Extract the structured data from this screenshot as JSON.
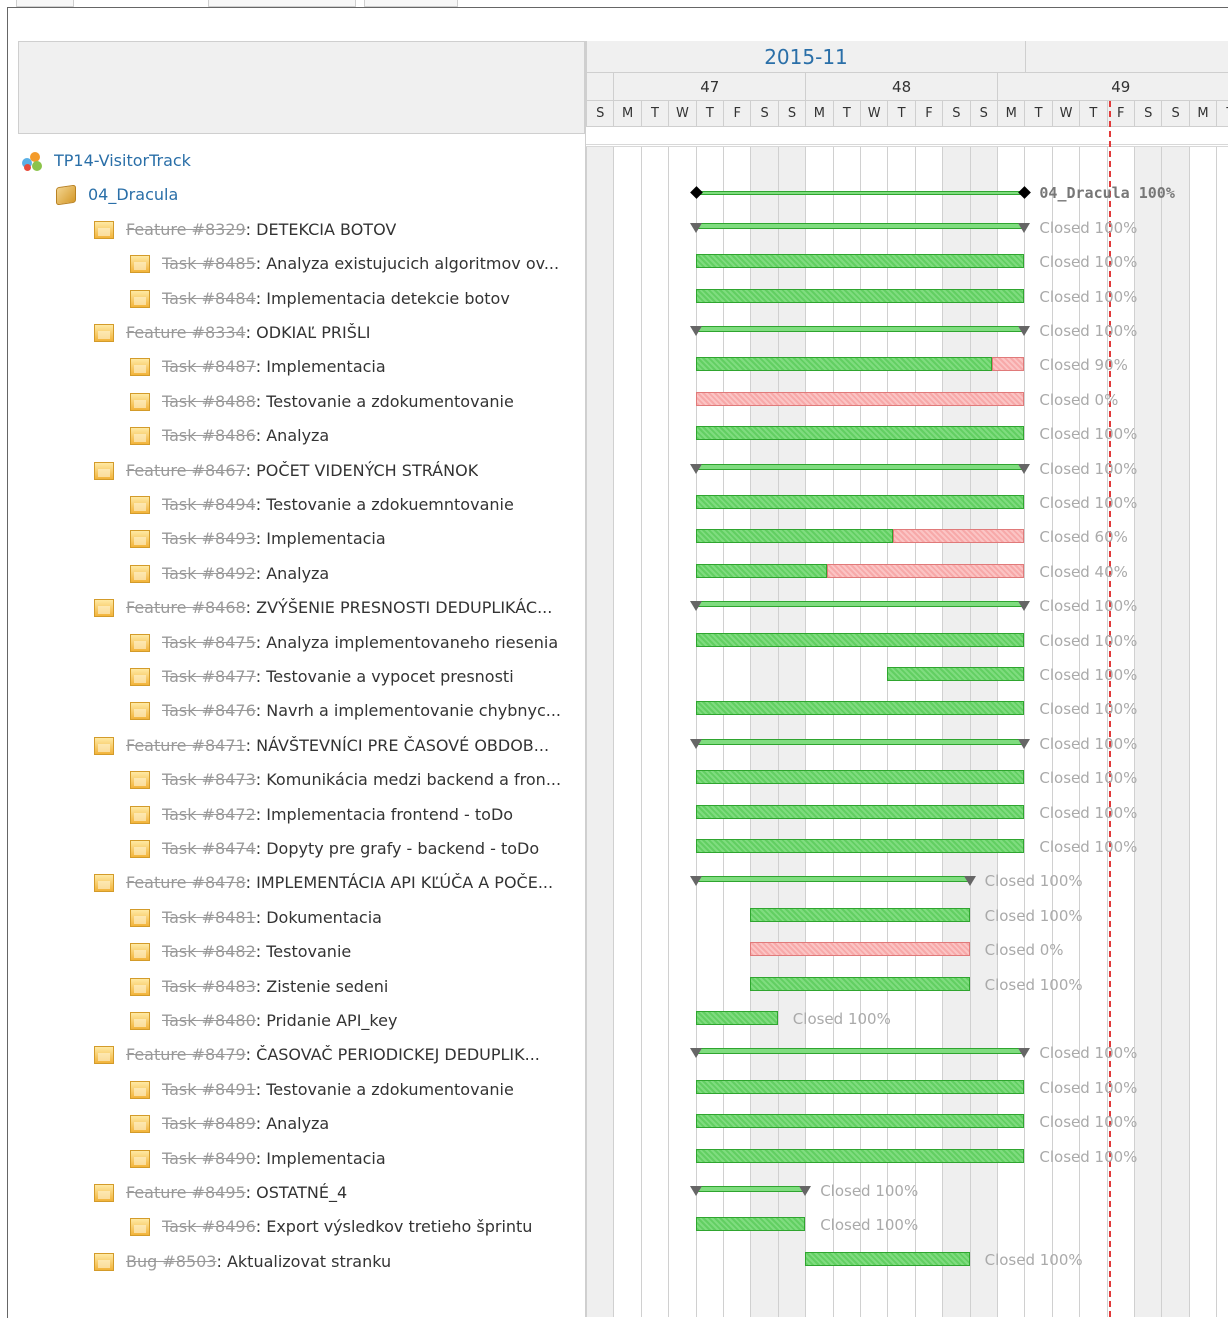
{
  "timeline": {
    "month": "2015-11",
    "weeks": [
      "47",
      "48",
      "49"
    ],
    "days": [
      "S",
      "M",
      "T",
      "W",
      "T",
      "F",
      "S",
      "S",
      "M",
      "T",
      "W",
      "T",
      "F",
      "S",
      "S",
      "M",
      "T",
      "W",
      "T",
      "F",
      "S",
      "S",
      "M",
      "T"
    ]
  },
  "tree": [
    {
      "type": "project",
      "label": "TP14-VisitorTrack"
    },
    {
      "type": "version",
      "label": "04_Dracula"
    },
    {
      "type": "feature",
      "id": "Feature #8329",
      "title": ": DETEKCIA BOTOV"
    },
    {
      "type": "task",
      "id": "Task #8485",
      "title": ": Analyza existujucich algoritmov ov..."
    },
    {
      "type": "task",
      "id": "Task #8484",
      "title": ": Implementacia detekcie botov"
    },
    {
      "type": "feature",
      "id": "Feature #8334",
      "title": ": ODKIAĽ PRIŠLI"
    },
    {
      "type": "task",
      "id": "Task #8487",
      "title": ": Implementacia"
    },
    {
      "type": "task",
      "id": "Task #8488",
      "title": ": Testovanie a zdokumentovanie"
    },
    {
      "type": "task",
      "id": "Task #8486",
      "title": ": Analyza"
    },
    {
      "type": "feature",
      "id": "Feature #8467",
      "title": ": POČET VIDENÝCH STRÁNOK"
    },
    {
      "type": "task",
      "id": "Task #8494",
      "title": ": Testovanie a zdokuemntovanie"
    },
    {
      "type": "task",
      "id": "Task #8493",
      "title": ": Implementacia"
    },
    {
      "type": "task",
      "id": "Task #8492",
      "title": ": Analyza"
    },
    {
      "type": "feature",
      "id": "Feature #8468",
      "title": ": ZVÝŠENIE PRESNOSTI DEDUPLIKÁC..."
    },
    {
      "type": "task",
      "id": "Task #8475",
      "title": ": Analyza implementovaneho riesenia"
    },
    {
      "type": "task",
      "id": "Task #8477",
      "title": ": Testovanie a vypocet presnosti"
    },
    {
      "type": "task",
      "id": "Task #8476",
      "title": ": Navrh a implementovanie chybnyc..."
    },
    {
      "type": "feature",
      "id": "Feature #8471",
      "title": ": NÁVŠTEVNÍCI PRE ČASOVÉ OBDOB..."
    },
    {
      "type": "task",
      "id": "Task #8473",
      "title": ": Komunikácia medzi backend a fron..."
    },
    {
      "type": "task",
      "id": "Task #8472",
      "title": ": Implementacia frontend - toDo"
    },
    {
      "type": "task",
      "id": "Task #8474",
      "title": ": Dopyty pre grafy - backend - toDo"
    },
    {
      "type": "feature",
      "id": "Feature #8478",
      "title": ": IMPLEMENTÁCIA API KĽÚČA A POČE..."
    },
    {
      "type": "task",
      "id": "Task #8481",
      "title": ": Dokumentacia"
    },
    {
      "type": "task",
      "id": "Task #8482",
      "title": ": Testovanie"
    },
    {
      "type": "task",
      "id": "Task #8483",
      "title": ": Zistenie sedeni"
    },
    {
      "type": "task",
      "id": "Task #8480",
      "title": ": Pridanie API_key"
    },
    {
      "type": "feature",
      "id": "Feature #8479",
      "title": ": ČASOVAČ PERIODICKEJ DEDUPLIK..."
    },
    {
      "type": "task",
      "id": "Task #8491",
      "title": ": Testovanie a zdokumentovanie"
    },
    {
      "type": "task",
      "id": "Task #8489",
      "title": ": Analyza"
    },
    {
      "type": "task",
      "id": "Task #8490",
      "title": ": Implementacia"
    },
    {
      "type": "feature",
      "id": "Feature #8495",
      "title": ": OSTATNÉ_4"
    },
    {
      "type": "task",
      "id": "Task #8496",
      "title": ": Export výsledkov tretieho šprintu"
    },
    {
      "type": "feature",
      "id": "Bug #8503",
      "title": ": Aktualizovat stranku"
    }
  ],
  "bars": [
    null,
    {
      "kind": "version",
      "start": 4,
      "end": 16,
      "label": "04_Dracula 100%"
    },
    {
      "kind": "parent",
      "start": 4,
      "end": 16,
      "label": "Closed 100%"
    },
    {
      "kind": "task",
      "start": 4,
      "end": 16,
      "done": 1.0,
      "label": "Closed 100%"
    },
    {
      "kind": "task",
      "start": 4,
      "end": 16,
      "done": 1.0,
      "label": "Closed 100%"
    },
    {
      "kind": "parent",
      "start": 4,
      "end": 16,
      "label": "Closed 100%"
    },
    {
      "kind": "task",
      "start": 4,
      "end": 16,
      "done": 0.9,
      "label": "Closed 90%"
    },
    {
      "kind": "task",
      "start": 4,
      "end": 16,
      "done": 0.0,
      "label": "Closed 0%"
    },
    {
      "kind": "task",
      "start": 4,
      "end": 16,
      "done": 1.0,
      "label": "Closed 100%"
    },
    {
      "kind": "parent",
      "start": 4,
      "end": 16,
      "label": "Closed 100%"
    },
    {
      "kind": "task",
      "start": 4,
      "end": 16,
      "done": 1.0,
      "label": "Closed 100%"
    },
    {
      "kind": "task",
      "start": 4,
      "end": 16,
      "done": 0.6,
      "label": "Closed 60%"
    },
    {
      "kind": "task",
      "start": 4,
      "end": 16,
      "done": 0.4,
      "label": "Closed 40%"
    },
    {
      "kind": "parent",
      "start": 4,
      "end": 16,
      "label": "Closed 100%"
    },
    {
      "kind": "task",
      "start": 4,
      "end": 16,
      "done": 1.0,
      "label": "Closed 100%"
    },
    {
      "kind": "task",
      "start": 11,
      "end": 16,
      "done": 1.0,
      "label": "Closed 100%"
    },
    {
      "kind": "task",
      "start": 4,
      "end": 16,
      "done": 1.0,
      "label": "Closed 100%"
    },
    {
      "kind": "parent",
      "start": 4,
      "end": 16,
      "label": "Closed 100%"
    },
    {
      "kind": "task",
      "start": 4,
      "end": 16,
      "done": 1.0,
      "label": "Closed 100%"
    },
    {
      "kind": "task",
      "start": 4,
      "end": 16,
      "done": 1.0,
      "label": "Closed 100%"
    },
    {
      "kind": "task",
      "start": 4,
      "end": 16,
      "done": 1.0,
      "label": "Closed 100%"
    },
    {
      "kind": "parent",
      "start": 4,
      "end": 14,
      "label": "Closed 100%"
    },
    {
      "kind": "task",
      "start": 6,
      "end": 14,
      "done": 1.0,
      "label": "Closed 100%"
    },
    {
      "kind": "task",
      "start": 6,
      "end": 14,
      "done": 0.0,
      "label": "Closed 0%"
    },
    {
      "kind": "task",
      "start": 6,
      "end": 14,
      "done": 1.0,
      "label": "Closed 100%"
    },
    {
      "kind": "task",
      "start": 4,
      "end": 7,
      "done": 1.0,
      "label": "Closed 100%"
    },
    {
      "kind": "parent",
      "start": 4,
      "end": 16,
      "label": "Closed 100%"
    },
    {
      "kind": "task",
      "start": 4,
      "end": 16,
      "done": 1.0,
      "label": "Closed 100%"
    },
    {
      "kind": "task",
      "start": 4,
      "end": 16,
      "done": 1.0,
      "label": "Closed 100%"
    },
    {
      "kind": "task",
      "start": 4,
      "end": 16,
      "done": 1.0,
      "label": "Closed 100%"
    },
    {
      "kind": "parent",
      "start": 4,
      "end": 8,
      "label": "Closed 100%"
    },
    {
      "kind": "task",
      "start": 4,
      "end": 8,
      "done": 1.0,
      "label": "Closed 100%"
    },
    {
      "kind": "task",
      "start": 8,
      "end": 14,
      "done": 1.0,
      "label": "Closed 100%"
    }
  ],
  "today_day_index": 19,
  "colors": {
    "done": "#7fdc7f",
    "todo": "#f7a9a9",
    "today": "#e23a3a",
    "link": "#2a6fa8"
  }
}
